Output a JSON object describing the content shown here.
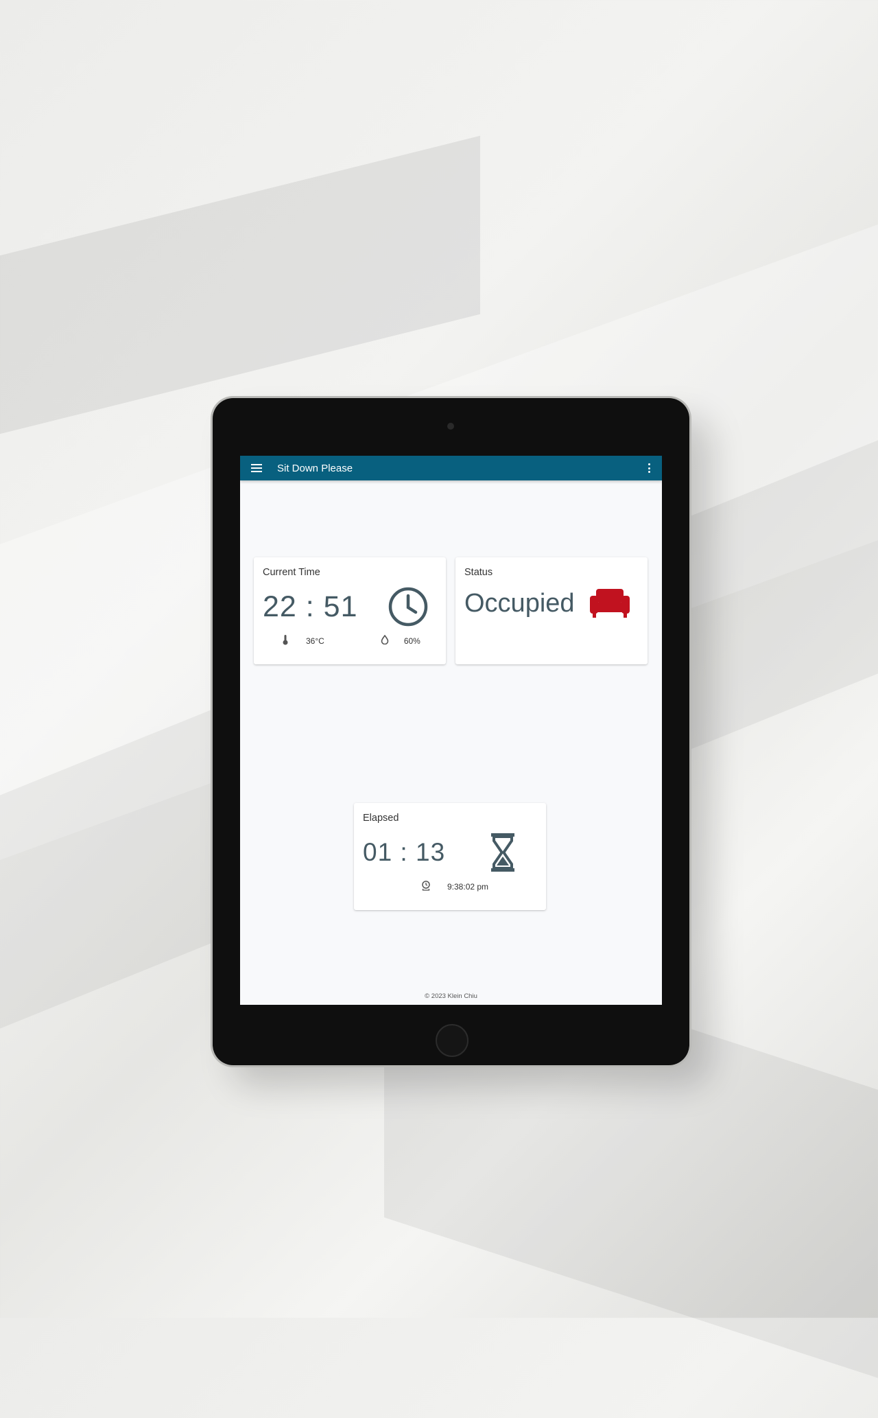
{
  "colors": {
    "appbar": "#08607f",
    "value_text": "#455a64",
    "status_icon": "#c1121f"
  },
  "appbar": {
    "title": "Sit Down Please",
    "menu_icon": "hamburger-menu-icon",
    "more_icon": "more-vertical-icon"
  },
  "current_time_card": {
    "title": "Current Time",
    "value": "22 : 51",
    "icon": "clock-icon",
    "temperature_icon": "thermometer-icon",
    "temperature": "36°C",
    "humidity_icon": "humidity-icon",
    "humidity": "60%"
  },
  "status_card": {
    "title": "Status",
    "value": "Occupied",
    "icon": "sofa-icon"
  },
  "elapsed_card": {
    "title": "Elapsed",
    "value": "01 : 13",
    "icon": "hourglass-icon",
    "start_icon": "alarm-clock-icon",
    "start_time": "9:38:02 pm"
  },
  "footer": {
    "copyright": "© 2023 Klein Chiu"
  }
}
